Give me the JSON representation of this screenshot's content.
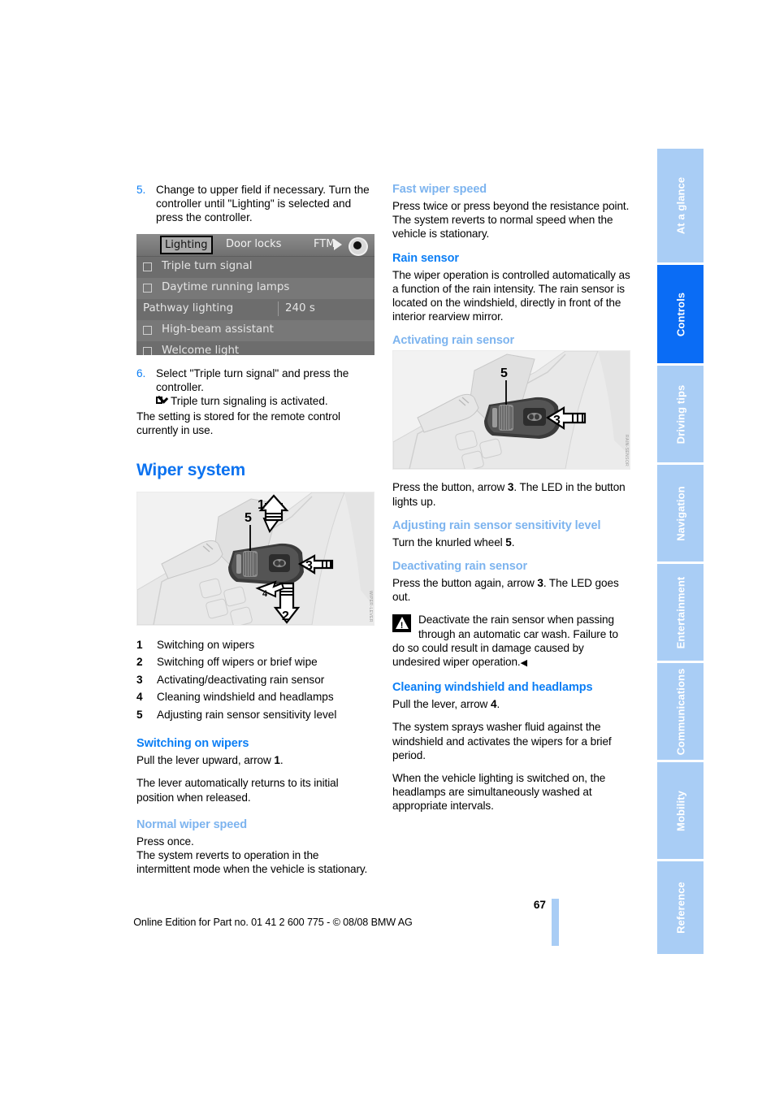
{
  "page": {
    "number": "67",
    "footer": "Online Edition for Part no. 01 41 2 600 775 - © 08/08 BMW AG"
  },
  "sidebar": {
    "tabs": [
      {
        "label": "At a glance",
        "active": false
      },
      {
        "label": "Controls",
        "active": true
      },
      {
        "label": "Driving tips",
        "active": false
      },
      {
        "label": "Navigation",
        "active": false
      },
      {
        "label": "Entertainment",
        "active": false
      },
      {
        "label": "Communications",
        "active": false
      },
      {
        "label": "Mobility",
        "active": false
      },
      {
        "label": "Reference",
        "active": false
      }
    ]
  },
  "left_column": {
    "step5": {
      "num": "5.",
      "text": "Change to upper field if necessary. Turn the controller until \"Lighting\" is selected and press the controller."
    },
    "idrive": {
      "tabs": {
        "selected": "Lighting",
        "second": "Door locks",
        "third": "FTM"
      },
      "rows": [
        {
          "label": "Triple turn signal",
          "checkbox": true,
          "value": ""
        },
        {
          "label": "Daytime running lamps",
          "checkbox": true,
          "value": ""
        },
        {
          "label": "Pathway lighting",
          "checkbox": false,
          "value": "240 s"
        },
        {
          "label": "High-beam assistant",
          "checkbox": true,
          "value": ""
        },
        {
          "label": "Welcome light",
          "checkbox": true,
          "value": ""
        }
      ]
    },
    "step6": {
      "num": "6.",
      "text": "Select \"Triple turn signal\" and press the controller.",
      "result": "Triple turn signaling is activated."
    },
    "stored_note": "The setting is stored for the remote control currently in use.",
    "heading": "Wiper system",
    "legend": [
      {
        "num": "1",
        "label": "Switching on wipers"
      },
      {
        "num": "2",
        "label": "Switching off wipers or brief wipe"
      },
      {
        "num": "3",
        "label": "Activating/deactivating rain sensor"
      },
      {
        "num": "4",
        "label": "Cleaning windshield and headlamps"
      },
      {
        "num": "5",
        "label": "Adjusting rain sensor sensitivity level"
      }
    ],
    "switching_on": {
      "heading": "Switching on wipers",
      "p1": "Pull the lever upward, arrow ",
      "p1_bold": "1",
      "p1_end": ".",
      "p2": "The lever automatically returns to its initial position when released."
    },
    "normal_speed": {
      "heading": "Normal wiper speed",
      "p1": "Press once.",
      "p2": "The system reverts to operation in the intermittent mode when the vehicle is stationary."
    }
  },
  "right_column": {
    "fast_speed": {
      "heading": "Fast wiper speed",
      "p1": "Press twice or press beyond the resistance point.",
      "p2": "The system reverts to normal speed when the vehicle is stationary."
    },
    "rain_sensor": {
      "heading": "Rain sensor",
      "p1": "The wiper operation is controlled automatically as a function of the rain intensity. The rain sensor is located on the windshield, directly in front of the interior rearview mirror."
    },
    "activating": {
      "heading": "Activating rain sensor",
      "p1_a": "Press the button, arrow ",
      "p1_bold": "3",
      "p1_b": ". The LED in the button lights up."
    },
    "adjusting": {
      "heading": "Adjusting rain sensor sensitivity level",
      "p1_a": "Turn the knurled wheel ",
      "p1_bold": "5",
      "p1_b": "."
    },
    "deactivating": {
      "heading": "Deactivating rain sensor",
      "p1_a": "Press the button again, arrow ",
      "p1_bold": "3",
      "p1_b": ". The LED goes out.",
      "warning": "Deactivate the rain sensor when passing through an automatic car wash. Failure to do so could result in damage caused by undesired wiper operation."
    },
    "cleaning": {
      "heading": "Cleaning windshield and headlamps",
      "p1_a": "Pull the lever, arrow ",
      "p1_bold": "4",
      "p1_b": ".",
      "p2": "The system sprays washer fluid against the windshield and activates the wipers for a brief period.",
      "p3": "When the vehicle lighting is switched on, the headlamps are simultaneously washed at appropriate intervals."
    }
  },
  "colors": {
    "heading_blue": "#0b72f0",
    "sub_blue": "#0b7ef5",
    "light_blue": "#7db4ef",
    "tab_inactive": "#a9cdf5",
    "tab_active": "#0a6cf5"
  }
}
